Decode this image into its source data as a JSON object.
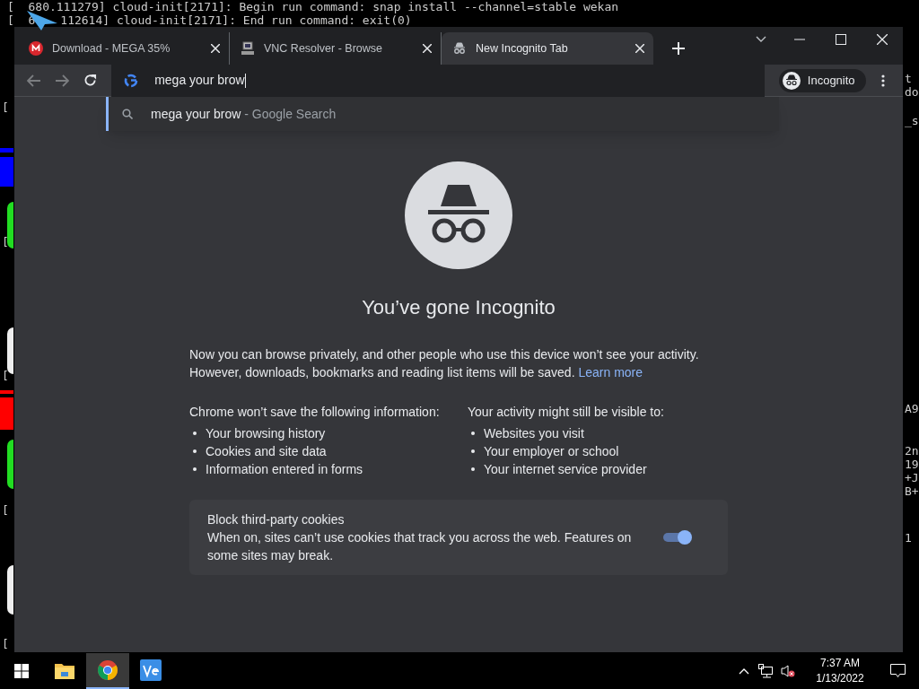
{
  "terminal": {
    "lines": [
      {
        "prefix": "[  680.111279]",
        "text": "cloud-init[2171]: Begin run command: snap install --channel=stable wekan"
      },
      {
        "prefix": "[  6",
        "text": "112614] cloud-init[2171]: End run command: exit(0)"
      }
    ],
    "left_marks": [
      "[",
      "[",
      "[",
      "[",
      "["
    ],
    "right_fragments": [
      "t",
      "do",
      "_s",
      "A9",
      "2n",
      "19",
      "+J",
      "B+",
      "1"
    ]
  },
  "browser": {
    "tabs": [
      {
        "kind": "mega",
        "title": "Download - MEGA 35%",
        "selected": false
      },
      {
        "kind": "computer",
        "title": "VNC Resolver - Browse",
        "selected": false
      },
      {
        "kind": "incognito",
        "title": "New Incognito Tab",
        "selected": true
      }
    ],
    "omnibox": {
      "value": "mega your brow"
    },
    "suggestion": {
      "query": "mega your brow",
      "suffix": "- Google Search"
    },
    "profile": "Incognito",
    "page": {
      "heading": "You’ve gone Incognito",
      "intro": "Now you can browse privately, and other people who use this device won’t see your activity. However, downloads, bookmarks and reading list items will be saved.",
      "link": "Learn more",
      "columns": [
        {
          "heading": "Chrome won’t save the following information:",
          "items": [
            "Your browsing history",
            "Cookies and site data",
            "Information entered in forms"
          ]
        },
        {
          "heading": "Your activity might still be visible to:",
          "items": [
            "Websites you visit",
            "Your employer or school",
            "Your internet service provider"
          ]
        }
      ],
      "cookies": {
        "title": "Block third-party cookies",
        "description": "When on, sites can’t use cookies that track you across the web. Features on some sites may break.",
        "on": true
      }
    }
  },
  "taskbar": {
    "apps": [
      {
        "kind": "folder",
        "selected": false
      },
      {
        "kind": "chrome",
        "selected": true
      },
      {
        "kind": "ve",
        "selected": false
      }
    ],
    "time": "7:37 AM",
    "date": "1/13/2022"
  }
}
